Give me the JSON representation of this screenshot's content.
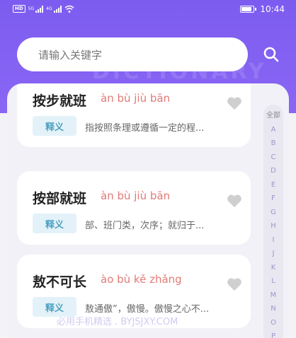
{
  "status": {
    "time": "10:44",
    "carrier_badge": "HD",
    "net_labels": [
      "5G",
      "4G"
    ]
  },
  "header": {
    "watermark": "DICTIONARY"
  },
  "search": {
    "placeholder": "请输入关键字"
  },
  "results": [
    {
      "word": "按步就班",
      "pinyin": "àn bù jiù bān",
      "tag": "释义",
      "meaning": "指按照条理或遵循一定的程..."
    },
    {
      "word": "按部就班",
      "pinyin": "àn bù jiù bān",
      "tag": "释义",
      "meaning": "部、班门类，次序；就归于..."
    },
    {
      "word": "敖不可长",
      "pinyin": "ào bù kě zhǎng",
      "tag": "释义",
      "meaning": "敖通傲”，傲慢。傲慢之心不..."
    }
  ],
  "index_bar": [
    "全部",
    "A",
    "B",
    "C",
    "D",
    "E",
    "F",
    "G",
    "H",
    "I",
    "J",
    "K",
    "L",
    "M",
    "N",
    "O",
    "P"
  ],
  "footer": {
    "watermark": "必用手机精选 . BYJSJXY.COM"
  },
  "colors": {
    "header": "#7c5cf0",
    "pinyin": "#e17a76",
    "tag_bg": "#e3f2f8",
    "tag_text": "#4aa0c2"
  }
}
